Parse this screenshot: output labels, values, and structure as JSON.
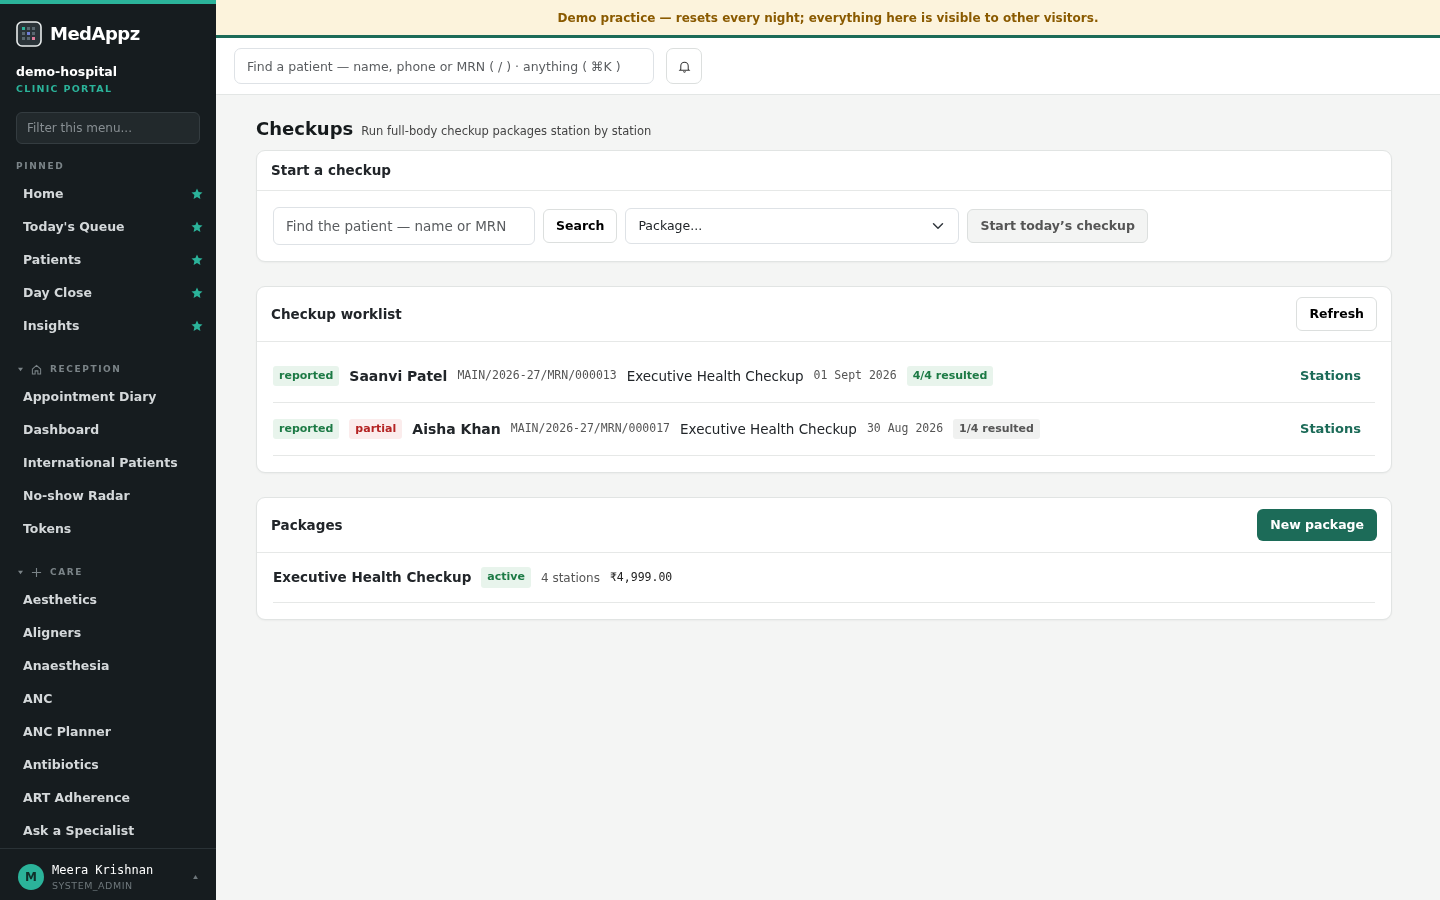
{
  "banner": "Demo practice — resets every night; everything here is visible to other visitors.",
  "sidebar": {
    "brand": "MedAppz",
    "tenant": "demo-hospital",
    "portal": "CLINIC PORTAL",
    "filter_placeholder": "Filter this menu...",
    "pinned": {
      "title": "PINNED",
      "items": [
        {
          "label": "Home",
          "starred": true
        },
        {
          "label": "Today's Queue",
          "starred": true
        },
        {
          "label": "Patients",
          "starred": true
        },
        {
          "label": "Day Close",
          "starred": true
        },
        {
          "label": "Insights",
          "starred": true
        }
      ]
    },
    "groups": [
      {
        "title": "RECEPTION",
        "kind": "home",
        "expanded": true,
        "items": [
          "Appointment Diary",
          "Dashboard",
          "International Patients",
          "No-show Radar",
          "Tokens"
        ]
      },
      {
        "title": "CARE",
        "kind": "plus",
        "expanded": true,
        "items": [
          "Aesthetics",
          "Aligners",
          "Anaesthesia",
          "ANC",
          "ANC Planner",
          "Antibiotics",
          "ART Adherence",
          "Ask a Specialist"
        ]
      }
    ],
    "user": {
      "initial": "M",
      "name": "Meera Krishnan",
      "role": "SYSTEM_ADMIN"
    }
  },
  "topbar": {
    "search_placeholder": "Find a patient — name, phone or MRN ( / ) · anything ( ⌘K )"
  },
  "page": {
    "title": "Checkups",
    "subtitle": "Run full-body checkup packages station by station"
  },
  "start": {
    "title": "Start a checkup",
    "patient_placeholder": "Find the patient — name or MRN",
    "search_button": "Search",
    "package_select": "Package...",
    "start_button": "Start today’s checkup",
    "start_disabled": true
  },
  "worklist": {
    "title": "Checkup worklist",
    "refresh": "Refresh",
    "rows": [
      {
        "tags": [
          {
            "text": "reported",
            "kind": "success"
          }
        ],
        "patient": "Saanvi Patel",
        "mrn": "MAIN/2026-27/MRN/000013",
        "package": "Executive Health Checkup",
        "date": "01 Sept 2026",
        "progress": {
          "text": "4/4 resulted",
          "kind": "success"
        },
        "action": "Stations"
      },
      {
        "tags": [
          {
            "text": "reported",
            "kind": "success"
          },
          {
            "text": "partial",
            "kind": "danger"
          }
        ],
        "patient": "Aisha Khan",
        "mrn": "MAIN/2026-27/MRN/000017",
        "package": "Executive Health Checkup",
        "date": "30 Aug 2026",
        "progress": {
          "text": "1/4 resulted",
          "kind": "neutral"
        },
        "action": "Stations"
      }
    ]
  },
  "packages": {
    "title": "Packages",
    "new_button": "New package",
    "rows": [
      {
        "name": "Executive Health Checkup",
        "status": {
          "text": "active",
          "kind": "success"
        },
        "stations": "4 stations",
        "price": "₹4,999.00"
      }
    ]
  }
}
